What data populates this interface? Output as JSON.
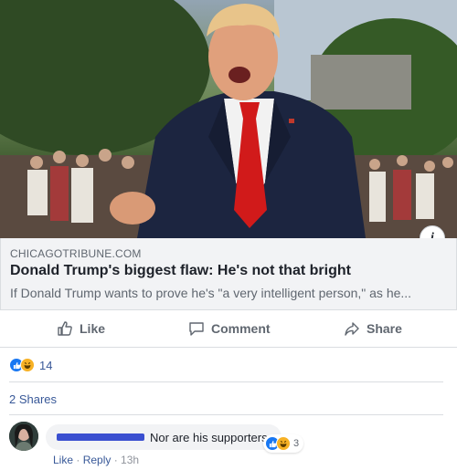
{
  "link_preview": {
    "domain": "CHICAGOTRIBUNE.COM",
    "headline": "Donald Trump's biggest flaw: He's not that bright",
    "description": "If Donald Trump wants to prove he's \"a very intelligent person,\" as he...",
    "info_button": "i"
  },
  "actions": {
    "like": "Like",
    "comment": "Comment",
    "share": "Share"
  },
  "reactions": {
    "count": "14",
    "icons": [
      "like-icon",
      "haha-icon"
    ]
  },
  "shares": {
    "label": "2 Shares"
  },
  "comment": {
    "text": "Nor are his supporters.",
    "reaction_count": "3",
    "like_link": "Like",
    "separator": " · ",
    "reply_link": "Reply",
    "time": "13h"
  },
  "colors": {
    "link_blue": "#385898",
    "like_blue": "#1877f2",
    "haha_yellow": "#f7b125",
    "tie_red": "#d11a1a",
    "suit_navy": "#1c2540"
  }
}
